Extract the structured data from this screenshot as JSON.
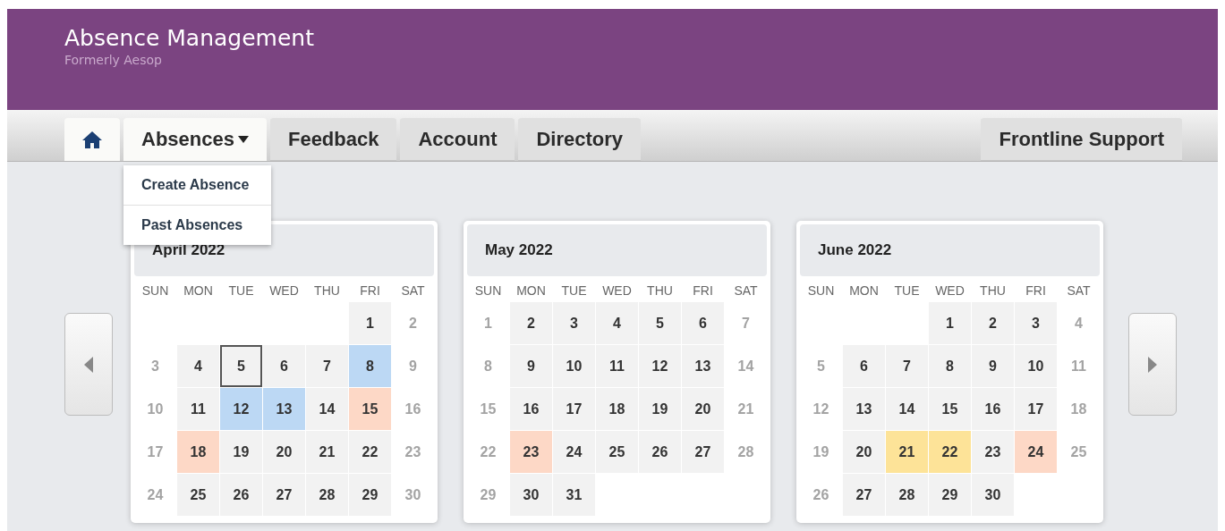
{
  "header": {
    "title": "Absence Management",
    "subtitle": "Formerly Aesop"
  },
  "nav": {
    "tabs": [
      {
        "kind": "home",
        "selected": true
      },
      {
        "kind": "menu",
        "label": "Absences",
        "selected": true,
        "menu": [
          "Create Absence",
          "Past Absences"
        ]
      },
      {
        "kind": "link",
        "label": "Feedback",
        "selected": false
      },
      {
        "kind": "link",
        "label": "Account",
        "selected": false
      },
      {
        "kind": "link",
        "label": "Directory",
        "selected": false
      }
    ],
    "support": {
      "label": "Frontline Support",
      "selected": false
    }
  },
  "months": [
    {
      "title": "April 2022",
      "weekdays": [
        "SUN",
        "MON",
        "TUE",
        "WED",
        "THU",
        "FRI",
        "SAT"
      ],
      "weeks": [
        [
          {
            "kind": "blank"
          },
          {
            "kind": "blank"
          },
          {
            "kind": "blank"
          },
          {
            "kind": "blank"
          },
          {
            "kind": "blank"
          },
          {
            "day": "1",
            "kind": "weekday"
          },
          {
            "day": "2",
            "kind": "weekend"
          }
        ],
        [
          {
            "day": "3",
            "kind": "weekend"
          },
          {
            "day": "4",
            "kind": "weekday"
          },
          {
            "day": "5",
            "kind": "today"
          },
          {
            "day": "6",
            "kind": "weekday"
          },
          {
            "day": "7",
            "kind": "weekday"
          },
          {
            "day": "8",
            "kind": "weekday",
            "color": "#bcd8f4"
          },
          {
            "day": "9",
            "kind": "weekend"
          }
        ],
        [
          {
            "day": "10",
            "kind": "weekend"
          },
          {
            "day": "11",
            "kind": "weekday"
          },
          {
            "day": "12",
            "kind": "weekday",
            "color": "#bcd8f4"
          },
          {
            "day": "13",
            "kind": "weekday",
            "color": "#bcd8f4"
          },
          {
            "day": "14",
            "kind": "weekday"
          },
          {
            "day": "15",
            "kind": "weekday",
            "color": "#fdd8c6"
          },
          {
            "day": "16",
            "kind": "weekend"
          }
        ],
        [
          {
            "day": "17",
            "kind": "weekend"
          },
          {
            "day": "18",
            "kind": "weekday",
            "color": "#fdd8c6"
          },
          {
            "day": "19",
            "kind": "weekday"
          },
          {
            "day": "20",
            "kind": "weekday"
          },
          {
            "day": "21",
            "kind": "weekday"
          },
          {
            "day": "22",
            "kind": "weekday"
          },
          {
            "day": "23",
            "kind": "weekend"
          }
        ],
        [
          {
            "day": "24",
            "kind": "weekend"
          },
          {
            "day": "25",
            "kind": "weekday"
          },
          {
            "day": "26",
            "kind": "weekday"
          },
          {
            "day": "27",
            "kind": "weekday"
          },
          {
            "day": "28",
            "kind": "weekday"
          },
          {
            "day": "29",
            "kind": "weekday"
          },
          {
            "day": "30",
            "kind": "weekend"
          }
        ]
      ]
    },
    {
      "title": "May 2022",
      "weekdays": [
        "SUN",
        "MON",
        "TUE",
        "WED",
        "THU",
        "FRI",
        "SAT"
      ],
      "weeks": [
        [
          {
            "day": "1",
            "kind": "weekend"
          },
          {
            "day": "2",
            "kind": "weekday"
          },
          {
            "day": "3",
            "kind": "weekday"
          },
          {
            "day": "4",
            "kind": "weekday"
          },
          {
            "day": "5",
            "kind": "weekday"
          },
          {
            "day": "6",
            "kind": "weekday"
          },
          {
            "day": "7",
            "kind": "weekend"
          }
        ],
        [
          {
            "day": "8",
            "kind": "weekend"
          },
          {
            "day": "9",
            "kind": "weekday"
          },
          {
            "day": "10",
            "kind": "weekday"
          },
          {
            "day": "11",
            "kind": "weekday"
          },
          {
            "day": "12",
            "kind": "weekday"
          },
          {
            "day": "13",
            "kind": "weekday"
          },
          {
            "day": "14",
            "kind": "weekend"
          }
        ],
        [
          {
            "day": "15",
            "kind": "weekend"
          },
          {
            "day": "16",
            "kind": "weekday"
          },
          {
            "day": "17",
            "kind": "weekday"
          },
          {
            "day": "18",
            "kind": "weekday"
          },
          {
            "day": "19",
            "kind": "weekday"
          },
          {
            "day": "20",
            "kind": "weekday"
          },
          {
            "day": "21",
            "kind": "weekend"
          }
        ],
        [
          {
            "day": "22",
            "kind": "weekend"
          },
          {
            "day": "23",
            "kind": "weekday",
            "color": "#fdd8c6"
          },
          {
            "day": "24",
            "kind": "weekday"
          },
          {
            "day": "25",
            "kind": "weekday"
          },
          {
            "day": "26",
            "kind": "weekday"
          },
          {
            "day": "27",
            "kind": "weekday"
          },
          {
            "day": "28",
            "kind": "weekend"
          }
        ],
        [
          {
            "day": "29",
            "kind": "weekend"
          },
          {
            "day": "30",
            "kind": "weekday"
          },
          {
            "day": "31",
            "kind": "weekday"
          },
          {
            "kind": "blank"
          },
          {
            "kind": "blank"
          },
          {
            "kind": "blank"
          },
          {
            "kind": "blank"
          }
        ]
      ]
    },
    {
      "title": "June 2022",
      "weekdays": [
        "SUN",
        "MON",
        "TUE",
        "WED",
        "THU",
        "FRI",
        "SAT"
      ],
      "weeks": [
        [
          {
            "kind": "blank"
          },
          {
            "kind": "blank"
          },
          {
            "kind": "blank"
          },
          {
            "day": "1",
            "kind": "weekday"
          },
          {
            "day": "2",
            "kind": "weekday"
          },
          {
            "day": "3",
            "kind": "weekday"
          },
          {
            "day": "4",
            "kind": "weekend"
          }
        ],
        [
          {
            "day": "5",
            "kind": "weekend"
          },
          {
            "day": "6",
            "kind": "weekday"
          },
          {
            "day": "7",
            "kind": "weekday"
          },
          {
            "day": "8",
            "kind": "weekday"
          },
          {
            "day": "9",
            "kind": "weekday"
          },
          {
            "day": "10",
            "kind": "weekday"
          },
          {
            "day": "11",
            "kind": "weekend"
          }
        ],
        [
          {
            "day": "12",
            "kind": "weekend"
          },
          {
            "day": "13",
            "kind": "weekday"
          },
          {
            "day": "14",
            "kind": "weekday"
          },
          {
            "day": "15",
            "kind": "weekday"
          },
          {
            "day": "16",
            "kind": "weekday"
          },
          {
            "day": "17",
            "kind": "weekday"
          },
          {
            "day": "18",
            "kind": "weekend"
          }
        ],
        [
          {
            "day": "19",
            "kind": "weekend"
          },
          {
            "day": "20",
            "kind": "weekday"
          },
          {
            "day": "21",
            "kind": "weekday",
            "color": "#fde398"
          },
          {
            "day": "22",
            "kind": "weekday",
            "color": "#fde398"
          },
          {
            "day": "23",
            "kind": "weekday"
          },
          {
            "day": "24",
            "kind": "weekday",
            "color": "#fdd8c6"
          },
          {
            "day": "25",
            "kind": "weekend"
          }
        ],
        [
          {
            "day": "26",
            "kind": "weekend"
          },
          {
            "day": "27",
            "kind": "weekday"
          },
          {
            "day": "28",
            "kind": "weekday"
          },
          {
            "day": "29",
            "kind": "weekday"
          },
          {
            "day": "30",
            "kind": "weekday"
          },
          {
            "kind": "blank"
          },
          {
            "kind": "blank"
          }
        ]
      ]
    }
  ]
}
